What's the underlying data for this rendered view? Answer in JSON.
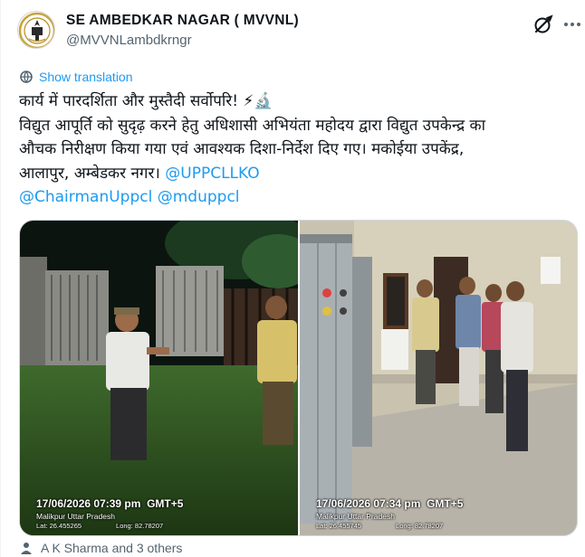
{
  "account": {
    "display_name": "SE AMBEDKAR NAGAR ( MVVNL)",
    "handle": "@MVVNLambdkrngr",
    "avatar_icon": "emblem-logo"
  },
  "actions": {
    "grok_icon": "grok-icon",
    "more_icon": "more-icon"
  },
  "translate": {
    "icon": "globe-icon",
    "label": "Show translation"
  },
  "tweet": {
    "line1": "कार्य में पारदर्शिता और मुस्तैदी सर्वोपरि! ⚡🔬",
    "line2": "विद्युत आपूर्ति को सुदृढ़ करने हेतु अधिशासी अभियंता महोदय द्वारा विद्युत उपकेन्द्र का",
    "line3": "औचक निरीक्षण किया गया एवं आवश्यक दिशा-निर्देश दिए गए। मकोईया उपकेंद्र,",
    "line4_text": "आलापुर, अम्बेडकर नगर। ",
    "mention1": "@UPPCLLKO",
    "mention2": "@ChairmanUppcl",
    "mention3": "@mduppcl"
  },
  "media": {
    "photo1": {
      "timestamp": "17/06/2026 07:39 pm",
      "tz": "GMT+5",
      "place": "Malikpur Uttar Pradesh",
      "lat": "Lat: 26.455265",
      "long": "Long: 82.78207"
    },
    "photo2": {
      "timestamp": "17/06/2026 07:34 pm",
      "tz": "GMT+5",
      "place": "Malikpur Uttar Pradesh",
      "lat": "Lat: 26.455745",
      "long": "Long: 82.78207"
    }
  },
  "footer": {
    "icon": "people-icon",
    "label": "A K Sharma and 3 others"
  },
  "colors": {
    "link": "#1d9bf0",
    "secondary": "#536471",
    "text": "#0f1419"
  }
}
